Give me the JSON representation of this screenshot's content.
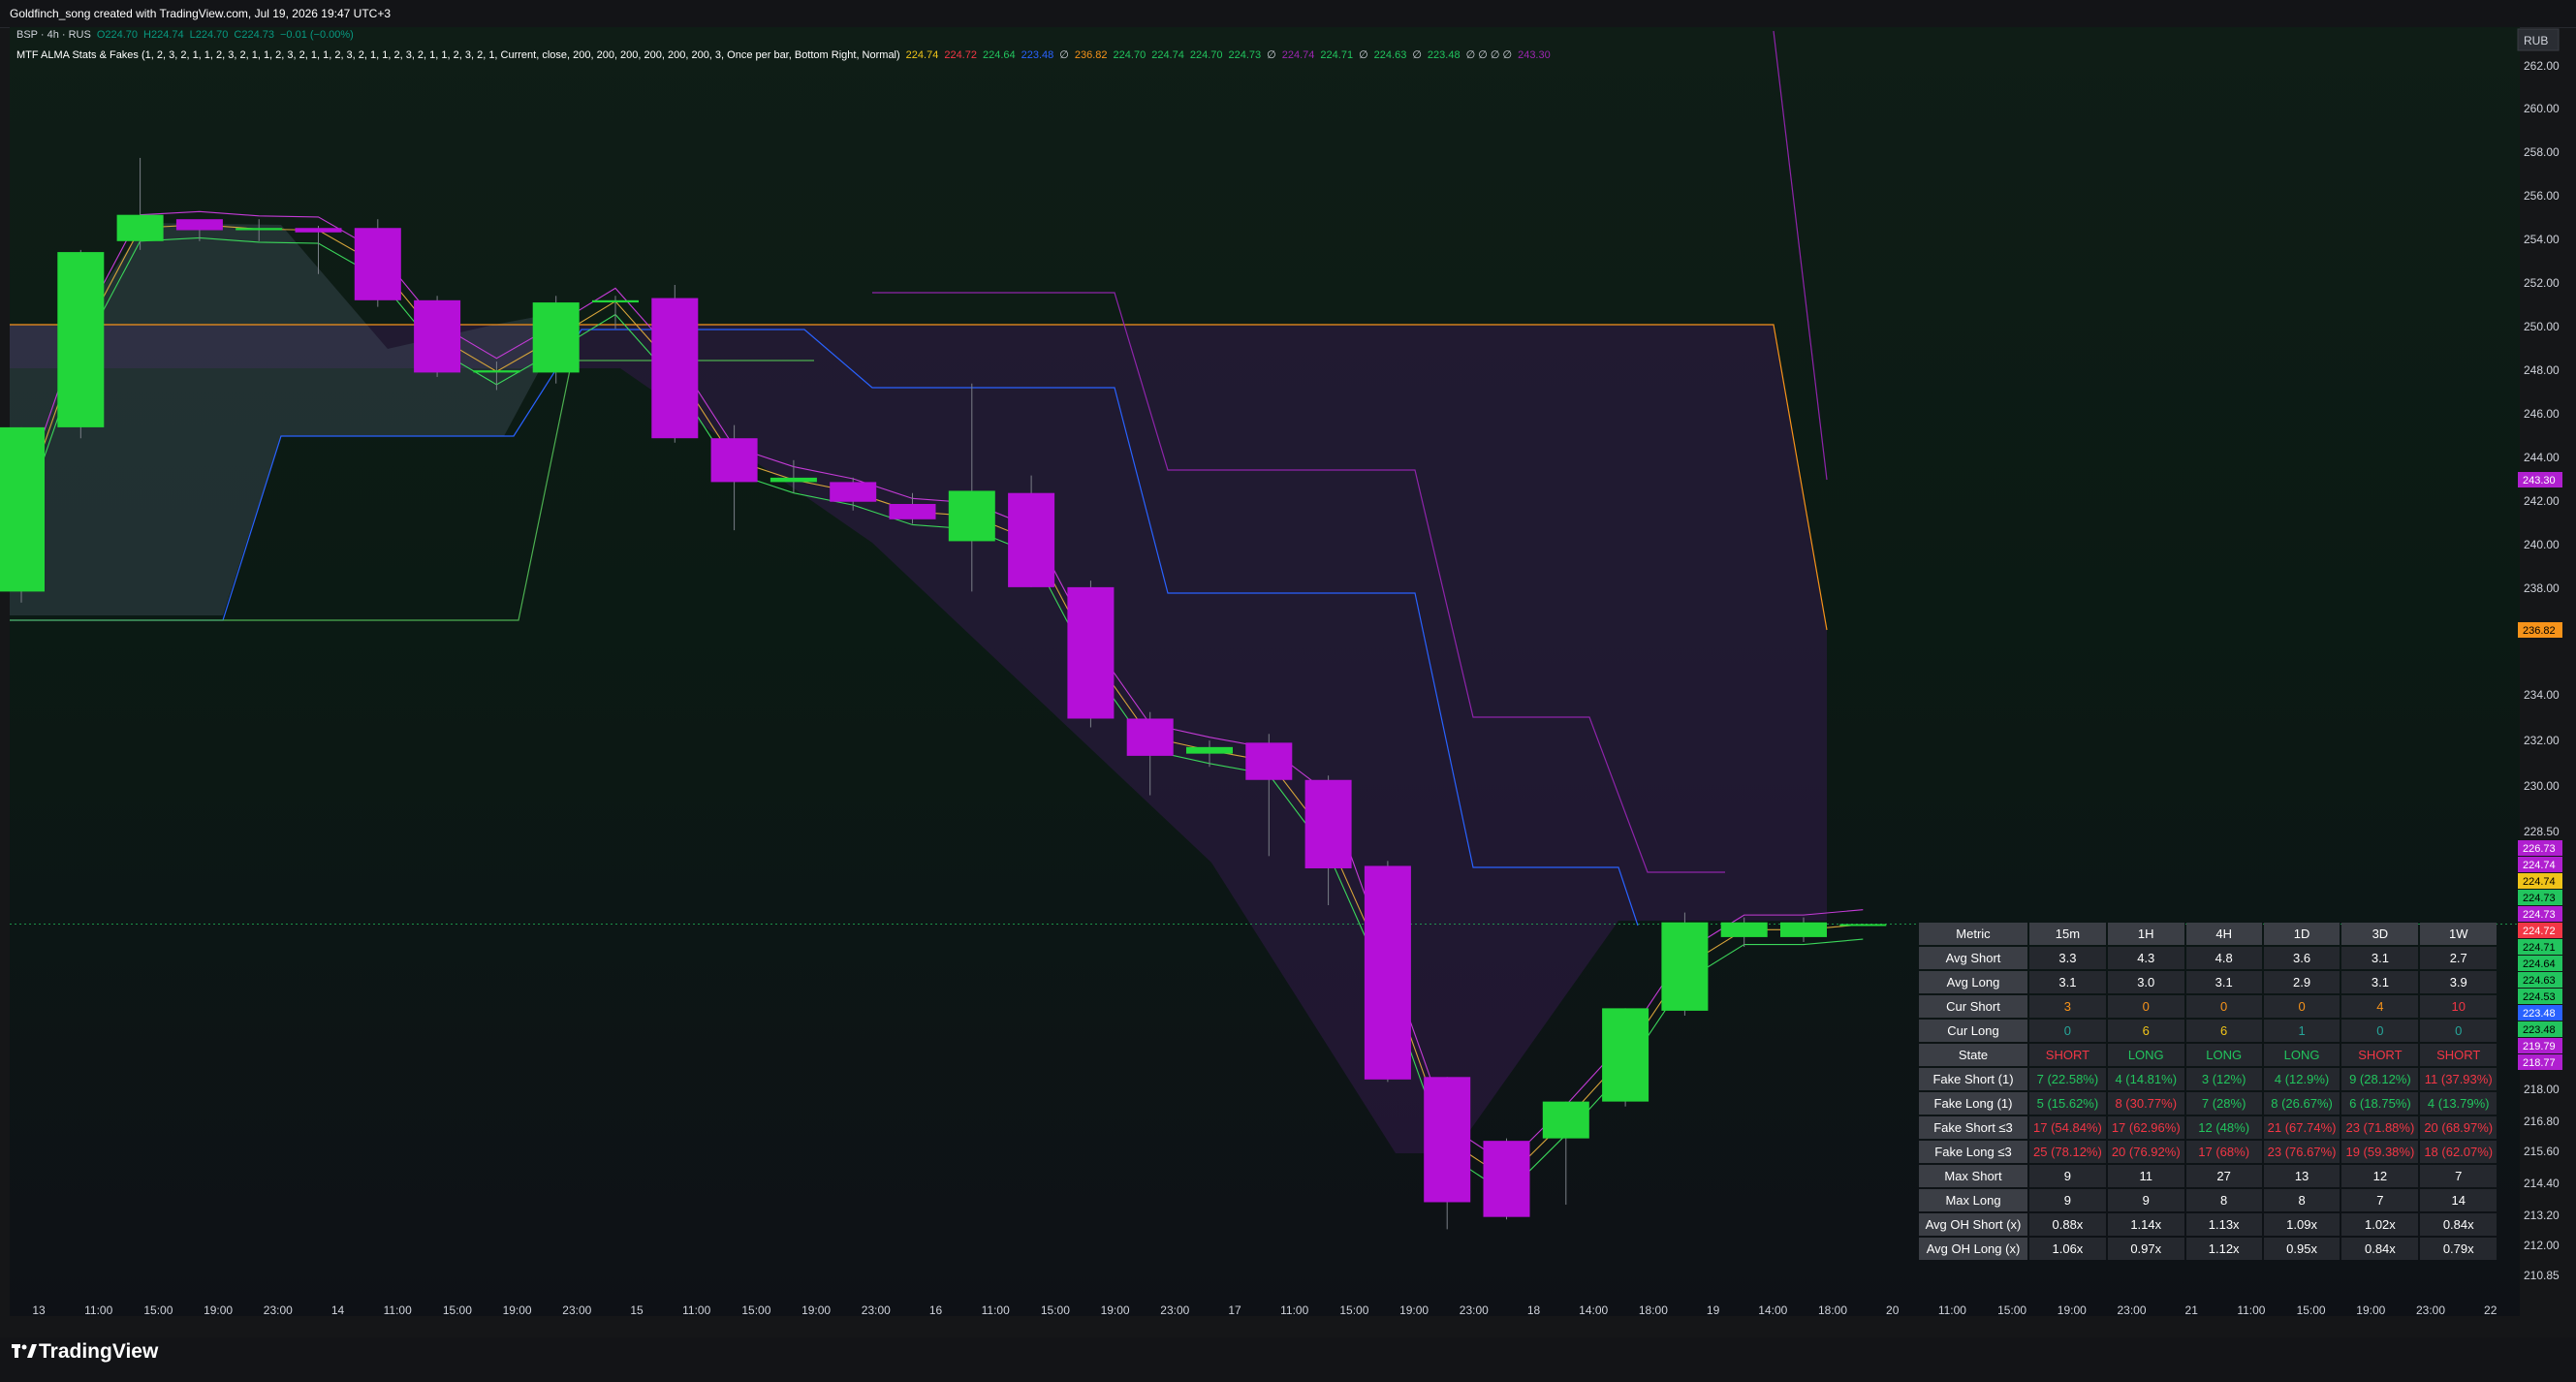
{
  "header": {
    "title": "Goldfinch_song created with TradingView.com, Jul 19, 2026 19:47 UTC+3"
  },
  "legend": {
    "symbol_line": [
      {
        "text": "BSP · 4h · RUS",
        "color": "#d1d4dc"
      },
      {
        "text": "O224.70",
        "color": "#089981"
      },
      {
        "text": "H224.74",
        "color": "#089981"
      },
      {
        "text": "L224.70",
        "color": "#089981"
      },
      {
        "text": "C224.73",
        "color": "#089981"
      },
      {
        "text": "−0.01 (−0.00%)",
        "color": "#089981"
      }
    ],
    "indicator_line": [
      {
        "text": "MTF ALMA Stats & Fakes (1, 2, 3, 2, 1, 1, 2, 3, 2, 1, 1, 2, 3, 2, 1, 1, 2, 3, 2, 1, 1, 2, 3, 2, 1, 1, 2, 3, 2, 1, Current, close, 200, 200, 200, 200, 200, 200, 3, Once per bar, Bottom Right, Normal)",
        "color": "#ffffff"
      },
      {
        "text": "224.74",
        "color": "#f0c419"
      },
      {
        "text": "224.72",
        "color": "#f23645"
      },
      {
        "text": "224.64",
        "color": "#22c55e"
      },
      {
        "text": "223.48",
        "color": "#2962ff"
      },
      {
        "text": "∅",
        "color": "#d1d4dc"
      },
      {
        "text": "236.82",
        "color": "#f7931a"
      },
      {
        "text": "224.70",
        "color": "#22c55e"
      },
      {
        "text": "224.74",
        "color": "#22c55e"
      },
      {
        "text": "224.70",
        "color": "#22c55e"
      },
      {
        "text": "224.73",
        "color": "#22c55e"
      },
      {
        "text": "∅",
        "color": "#d1d4dc"
      },
      {
        "text": "224.74",
        "color": "#9c27b0"
      },
      {
        "text": "224.71",
        "color": "#22c55e"
      },
      {
        "text": "∅",
        "color": "#d1d4dc"
      },
      {
        "text": "224.63",
        "color": "#22c55e"
      },
      {
        "text": "∅",
        "color": "#d1d4dc"
      },
      {
        "text": "223.48",
        "color": "#22c55e"
      },
      {
        "text": "∅ ∅ ∅ ∅",
        "color": "#d1d4dc"
      },
      {
        "text": "243.30",
        "color": "#9c27b0"
      }
    ]
  },
  "currency": "RUB",
  "price_axis": {
    "ticks": [
      "262.00",
      "260.00",
      "258.00",
      "256.00",
      "254.00",
      "252.00",
      "250.00",
      "248.00",
      "246.00",
      "244.00",
      "242.00",
      "240.00",
      "238.00",
      "236.00",
      "234.00",
      "232.00",
      "230.00",
      "228.50",
      "218.00",
      "216.80",
      "215.60",
      "214.40",
      "213.20",
      "212.00",
      "210.85"
    ],
    "tags": [
      {
        "price": 243.3,
        "text": "243.30",
        "bg": "#b01fd0",
        "fg": "#ffffff"
      },
      {
        "price": 236.82,
        "text": "236.82",
        "bg": "#f7931a",
        "fg": "#000000"
      },
      {
        "price": 226.73,
        "text": "226.73",
        "bg": "#b01fd0",
        "fg": "#ffffff"
      },
      {
        "price": 226.0,
        "text": "224.74",
        "bg": "#b01fd0",
        "fg": "#ffffff"
      },
      {
        "price": 225.25,
        "text": "224.74",
        "bg": "#f0c419",
        "fg": "#000000"
      },
      {
        "price": 224.5,
        "text": "224.73",
        "bg": "#22c55e",
        "fg": "#000000"
      },
      {
        "price": 223.75,
        "text": "224.73",
        "bg": "#b01fd0",
        "fg": "#ffffff"
      },
      {
        "price": 223.0,
        "text": "224.72",
        "bg": "#f23645",
        "fg": "#ffffff"
      },
      {
        "price": 222.25,
        "text": "224.71",
        "bg": "#22c55e",
        "fg": "#000000"
      },
      {
        "price": 221.5,
        "text": "224.64",
        "bg": "#22c55e",
        "fg": "#000000"
      },
      {
        "price": 220.75,
        "text": "224.63",
        "bg": "#22c55e",
        "fg": "#000000"
      },
      {
        "price": 220.0,
        "text": "224.53",
        "bg": "#22c55e",
        "fg": "#000000"
      },
      {
        "price": 219.25,
        "text": "223.48",
        "bg": "#2962ff",
        "fg": "#ffffff"
      },
      {
        "price": 218.5,
        "text": "223.48",
        "bg": "#22c55e",
        "fg": "#000000"
      },
      {
        "price": 217.75,
        "text": "219.79",
        "bg": "#b01fd0",
        "fg": "#ffffff"
      },
      {
        "price": 217.0,
        "text": "218.77",
        "bg": "#b01fd0",
        "fg": "#ffffff"
      }
    ]
  },
  "time_axis": [
    "13",
    "11:00",
    "15:00",
    "19:00",
    "23:00",
    "14",
    "11:00",
    "15:00",
    "19:00",
    "23:00",
    "15",
    "11:00",
    "15:00",
    "19:00",
    "23:00",
    "16",
    "11:00",
    "15:00",
    "19:00",
    "23:00",
    "17",
    "11:00",
    "15:00",
    "19:00",
    "23:00",
    "18",
    "14:00",
    "18:00",
    "19",
    "14:00",
    "18:00",
    "20",
    "11:00",
    "15:00",
    "19:00",
    "23:00",
    "21",
    "11:00",
    "15:00",
    "19:00",
    "23:00",
    "22"
  ],
  "stats_table": {
    "headers": [
      "Metric",
      "15m",
      "1H",
      "4H",
      "1D",
      "3D",
      "1W"
    ],
    "rows": [
      {
        "metric": "Avg Short",
        "cells": [
          {
            "t": "3.3",
            "c": "#ffffff"
          },
          {
            "t": "4.3",
            "c": "#ffffff"
          },
          {
            "t": "4.8",
            "c": "#ffffff"
          },
          {
            "t": "3.6",
            "c": "#ffffff"
          },
          {
            "t": "3.1",
            "c": "#ffffff"
          },
          {
            "t": "2.7",
            "c": "#ffffff"
          }
        ]
      },
      {
        "metric": "Avg Long",
        "cells": [
          {
            "t": "3.1",
            "c": "#ffffff"
          },
          {
            "t": "3.0",
            "c": "#ffffff"
          },
          {
            "t": "3.1",
            "c": "#ffffff"
          },
          {
            "t": "2.9",
            "c": "#ffffff"
          },
          {
            "t": "3.1",
            "c": "#ffffff"
          },
          {
            "t": "3.9",
            "c": "#ffffff"
          }
        ]
      },
      {
        "metric": "Cur Short",
        "cells": [
          {
            "t": "3",
            "c": "#f7931a"
          },
          {
            "t": "0",
            "c": "#f7931a"
          },
          {
            "t": "0",
            "c": "#f7931a"
          },
          {
            "t": "0",
            "c": "#f7931a"
          },
          {
            "t": "4",
            "c": "#f7931a"
          },
          {
            "t": "10",
            "c": "#f23645"
          }
        ]
      },
      {
        "metric": "Cur Long",
        "cells": [
          {
            "t": "0",
            "c": "#26a69a"
          },
          {
            "t": "6",
            "c": "#f0c419"
          },
          {
            "t": "6",
            "c": "#f0c419"
          },
          {
            "t": "1",
            "c": "#26a69a"
          },
          {
            "t": "0",
            "c": "#26a69a"
          },
          {
            "t": "0",
            "c": "#26a69a"
          }
        ]
      },
      {
        "metric": "State",
        "cells": [
          {
            "t": "SHORT",
            "c": "#f23645"
          },
          {
            "t": "LONG",
            "c": "#22c55e"
          },
          {
            "t": "LONG",
            "c": "#22c55e"
          },
          {
            "t": "LONG",
            "c": "#22c55e"
          },
          {
            "t": "SHORT",
            "c": "#f23645"
          },
          {
            "t": "SHORT",
            "c": "#f23645"
          }
        ]
      },
      {
        "metric": "Fake Short (1)",
        "cells": [
          {
            "t": "7 (22.58%)",
            "c": "#22c55e"
          },
          {
            "t": "4 (14.81%)",
            "c": "#22c55e"
          },
          {
            "t": "3 (12%)",
            "c": "#22c55e"
          },
          {
            "t": "4 (12.9%)",
            "c": "#22c55e"
          },
          {
            "t": "9 (28.12%)",
            "c": "#22c55e"
          },
          {
            "t": "11 (37.93%)",
            "c": "#f23645"
          }
        ]
      },
      {
        "metric": "Fake Long (1)",
        "cells": [
          {
            "t": "5 (15.62%)",
            "c": "#22c55e"
          },
          {
            "t": "8 (30.77%)",
            "c": "#f23645"
          },
          {
            "t": "7 (28%)",
            "c": "#22c55e"
          },
          {
            "t": "8 (26.67%)",
            "c": "#22c55e"
          },
          {
            "t": "6 (18.75%)",
            "c": "#22c55e"
          },
          {
            "t": "4 (13.79%)",
            "c": "#22c55e"
          }
        ]
      },
      {
        "metric": "Fake Short ≤3",
        "cells": [
          {
            "t": "17 (54.84%)",
            "c": "#f23645"
          },
          {
            "t": "17 (62.96%)",
            "c": "#f23645"
          },
          {
            "t": "12 (48%)",
            "c": "#22c55e"
          },
          {
            "t": "21 (67.74%)",
            "c": "#f23645"
          },
          {
            "t": "23 (71.88%)",
            "c": "#f23645"
          },
          {
            "t": "20 (68.97%)",
            "c": "#f23645"
          }
        ]
      },
      {
        "metric": "Fake Long ≤3",
        "cells": [
          {
            "t": "25 (78.12%)",
            "c": "#f23645"
          },
          {
            "t": "20 (76.92%)",
            "c": "#f23645"
          },
          {
            "t": "17 (68%)",
            "c": "#f23645"
          },
          {
            "t": "23 (76.67%)",
            "c": "#f23645"
          },
          {
            "t": "19 (59.38%)",
            "c": "#f23645"
          },
          {
            "t": "18 (62.07%)",
            "c": "#f23645"
          }
        ]
      },
      {
        "metric": "Max Short",
        "cells": [
          {
            "t": "9",
            "c": "#ffffff"
          },
          {
            "t": "11",
            "c": "#ffffff"
          },
          {
            "t": "27",
            "c": "#ffffff"
          },
          {
            "t": "13",
            "c": "#ffffff"
          },
          {
            "t": "12",
            "c": "#ffffff"
          },
          {
            "t": "7",
            "c": "#ffffff"
          }
        ]
      },
      {
        "metric": "Max Long",
        "cells": [
          {
            "t": "9",
            "c": "#ffffff"
          },
          {
            "t": "9",
            "c": "#ffffff"
          },
          {
            "t": "8",
            "c": "#ffffff"
          },
          {
            "t": "8",
            "c": "#ffffff"
          },
          {
            "t": "7",
            "c": "#ffffff"
          },
          {
            "t": "14",
            "c": "#ffffff"
          }
        ]
      },
      {
        "metric": "Avg OH Short (x)",
        "cells": [
          {
            "t": "0.88x",
            "c": "#ffffff"
          },
          {
            "t": "1.14x",
            "c": "#ffffff"
          },
          {
            "t": "1.13x",
            "c": "#ffffff"
          },
          {
            "t": "1.09x",
            "c": "#ffffff"
          },
          {
            "t": "1.02x",
            "c": "#ffffff"
          },
          {
            "t": "0.84x",
            "c": "#ffffff"
          }
        ]
      },
      {
        "metric": "Avg OH Long (x)",
        "cells": [
          {
            "t": "1.06x",
            "c": "#ffffff"
          },
          {
            "t": "0.97x",
            "c": "#ffffff"
          },
          {
            "t": "1.12x",
            "c": "#ffffff"
          },
          {
            "t": "0.95x",
            "c": "#ffffff"
          },
          {
            "t": "0.84x",
            "c": "#ffffff"
          },
          {
            "t": "0.79x",
            "c": "#ffffff"
          }
        ]
      }
    ]
  },
  "colors": {
    "up": "#22d63a",
    "down": "#b50fd8",
    "bg": "#0d1b15",
    "blue": "#2962ff",
    "orange": "#f7931a",
    "purple": "#9c27b0",
    "green": "#4caf50"
  },
  "chart_data": {
    "type": "candlestick",
    "symbol": "BSP",
    "timeframe": "4h",
    "exchange": "RUS",
    "candles": [
      {
        "o": 238.0,
        "h": 245.5,
        "l": 237.5,
        "c": 245.5
      },
      {
        "o": 245.5,
        "h": 253.6,
        "l": 245.0,
        "c": 253.5
      },
      {
        "o": 254.0,
        "h": 257.8,
        "l": 253.6,
        "c": 255.2
      },
      {
        "o": 255.0,
        "h": 254.8,
        "l": 254.0,
        "c": 254.5
      },
      {
        "o": 254.5,
        "h": 255.0,
        "l": 254.0,
        "c": 254.6
      },
      {
        "o": 254.6,
        "h": 254.7,
        "l": 252.5,
        "c": 254.4
      },
      {
        "o": 254.6,
        "h": 255.0,
        "l": 251.0,
        "c": 251.3
      },
      {
        "o": 251.3,
        "h": 251.5,
        "l": 247.8,
        "c": 248.0
      },
      {
        "o": 248.0,
        "h": 248.5,
        "l": 247.2,
        "c": 248.1
      },
      {
        "o": 248.0,
        "h": 251.5,
        "l": 247.5,
        "c": 251.2
      },
      {
        "o": 251.2,
        "h": 251.5,
        "l": 250.0,
        "c": 251.3
      },
      {
        "o": 251.4,
        "h": 252.0,
        "l": 244.8,
        "c": 245.0
      },
      {
        "o": 245.0,
        "h": 245.6,
        "l": 240.8,
        "c": 243.0
      },
      {
        "o": 243.0,
        "h": 244.0,
        "l": 242.5,
        "c": 243.2
      },
      {
        "o": 243.0,
        "h": 243.2,
        "l": 241.7,
        "c": 242.1
      },
      {
        "o": 242.0,
        "h": 242.5,
        "l": 241.1,
        "c": 241.3
      },
      {
        "o": 240.3,
        "h": 247.5,
        "l": 238.0,
        "c": 242.6
      },
      {
        "o": 242.5,
        "h": 243.3,
        "l": 238.2,
        "c": 238.2
      },
      {
        "o": 238.2,
        "h": 238.5,
        "l": 231.8,
        "c": 232.2
      },
      {
        "o": 232.2,
        "h": 232.5,
        "l": 228.7,
        "c": 230.5
      },
      {
        "o": 230.6,
        "h": 231.2,
        "l": 230.0,
        "c": 230.9
      },
      {
        "o": 231.1,
        "h": 231.5,
        "l": 227.5,
        "c": 229.4
      },
      {
        "o": 229.4,
        "h": 229.6,
        "l": 225.5,
        "c": 227.0
      },
      {
        "o": 227.1,
        "h": 227.3,
        "l": 218.3,
        "c": 218.4
      },
      {
        "o": 218.5,
        "h": 218.5,
        "l": 212.3,
        "c": 213.4
      },
      {
        "o": 215.9,
        "h": 216.0,
        "l": 212.7,
        "c": 212.8
      },
      {
        "o": 216.0,
        "h": 217.5,
        "l": 213.3,
        "c": 217.5
      },
      {
        "o": 217.5,
        "h": 221.3,
        "l": 217.3,
        "c": 221.3
      },
      {
        "o": 221.2,
        "h": 225.2,
        "l": 221.0,
        "c": 224.8
      },
      {
        "o": 224.2,
        "h": 225.0,
        "l": 223.8,
        "c": 224.8
      },
      {
        "o": 224.2,
        "h": 225.0,
        "l": 224.0,
        "c": 224.8
      },
      {
        "o": 224.7,
        "h": 224.74,
        "l": 224.7,
        "c": 224.73
      }
    ],
    "last_price": 224.73
  }
}
